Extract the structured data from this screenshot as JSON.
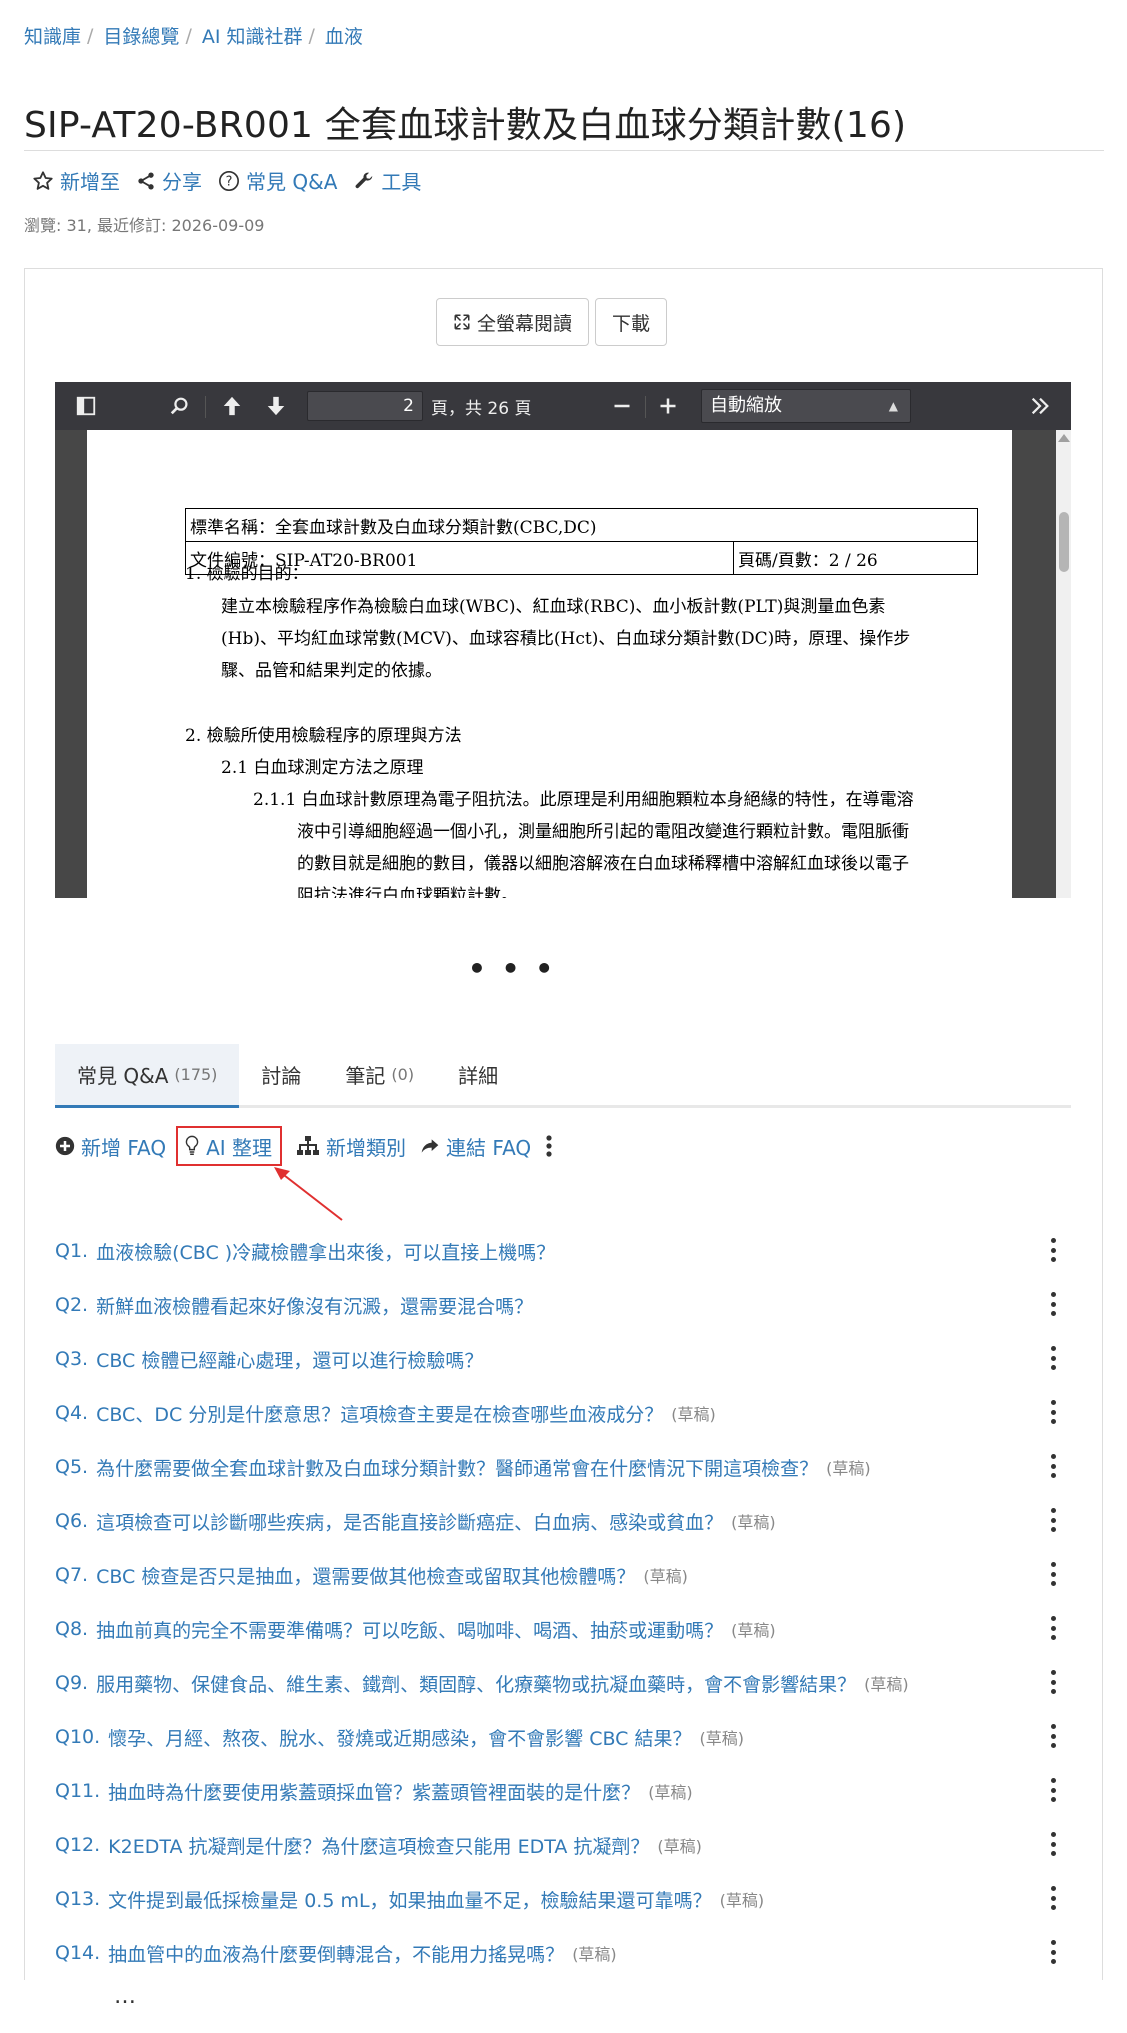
{
  "breadcrumb": [
    "知識庫",
    "目錄總覽",
    "AI 知識社群",
    "血液"
  ],
  "title": "SIP-AT20-BR001 全套血球計數及白血球分類計數(16)",
  "actions": {
    "add": "新增至",
    "share": "分享",
    "faq": "常見 Q&A",
    "tools": "工具"
  },
  "meta": "瀏覽: 31, 最近修訂: 2026-09-09",
  "buttons": {
    "fullscreen": "全螢幕閱讀",
    "download": "下載"
  },
  "viewer": {
    "page": "2",
    "page_of": "頁，共 26 頁",
    "zoom": "自動縮放",
    "doc": {
      "std_name": "標準名稱：全套血球計數及白血球分類計數(CBC,DC)",
      "doc_no": "文件編號：SIP-AT20-BR001",
      "page_info": "頁碼/頁數：2 / 26",
      "s1_title": "1.   檢驗的目的：",
      "s1_l1": "建立本檢驗程序作為檢驗白血球(WBC)、紅血球(RBC)、血小板計數(PLT)與測量血色素",
      "s1_l2": "(Hb)、平均紅血球常數(MCV)、血球容積比(Hct)、白血球分類計數(DC)時，原理、操作步",
      "s1_l3": "驟、品管和結果判定的依據。",
      "s2_title": "2.   檢驗所使用檢驗程序的原理與方法",
      "s21_title": "2.1   白血球測定方法之原理",
      "s211_l1": "2.1.1 白血球計數原理為電子阻抗法。此原理是利用細胞顆粒本身絕緣的特性，在導電溶",
      "s211_l2": "液中引導細胞經過一個小孔，測量細胞所引起的電阻改變進行顆粒計數。電阻脈衝",
      "s211_l3": "的數目就是細胞的數目，儀器以細胞溶解液在白血球稀釋槽中溶解紅血球後以電子",
      "s211_l4": "阻抗法進行白血球顆粒計數。"
    }
  },
  "center_ellipsis": "• • •",
  "tabs": [
    {
      "label": "常見 Q&A",
      "count": "(175)"
    },
    {
      "label": "討論",
      "count": ""
    },
    {
      "label": "筆記",
      "count": "(0)"
    },
    {
      "label": "詳細",
      "count": ""
    }
  ],
  "faq_tools": {
    "add": "新增 FAQ",
    "ai": "AI 整理",
    "category": "新增類別",
    "link": "連結 FAQ"
  },
  "faqs": [
    {
      "n": "Q1.",
      "q": "血液檢驗(CBC )冷藏檢體拿出來後，可以直接上機嗎？",
      "draft": ""
    },
    {
      "n": "Q2.",
      "q": "新鮮血液檢體看起來好像沒有沉澱，還需要混合嗎？",
      "draft": ""
    },
    {
      "n": "Q3.",
      "q": "CBC 檢體已經離心處理，還可以進行檢驗嗎？",
      "draft": ""
    },
    {
      "n": "Q4.",
      "q": "CBC、DC 分別是什麼意思？這項檢查主要是在檢查哪些血液成分？",
      "draft": "(草稿)"
    },
    {
      "n": "Q5.",
      "q": "為什麼需要做全套血球計數及白血球分類計數？醫師通常會在什麼情況下開這項檢查？",
      "draft": "(草稿)"
    },
    {
      "n": "Q6.",
      "q": "這項檢查可以診斷哪些疾病，是否能直接診斷癌症、白血病、感染或貧血？",
      "draft": "(草稿)"
    },
    {
      "n": "Q7.",
      "q": "CBC 檢查是否只是抽血，還需要做其他檢查或留取其他檢體嗎？",
      "draft": "(草稿)"
    },
    {
      "n": "Q8.",
      "q": "抽血前真的完全不需要準備嗎？可以吃飯、喝咖啡、喝酒、抽菸或運動嗎？",
      "draft": "(草稿)"
    },
    {
      "n": "Q9.",
      "q": "服用藥物、保健食品、維生素、鐵劑、類固醇、化療藥物或抗凝血藥時，會不會影響結果？",
      "draft": "(草稿)"
    },
    {
      "n": "Q10.",
      "q": "懷孕、月經、熬夜、脫水、發燒或近期感染，會不會影響 CBC 結果？",
      "draft": "(草稿)"
    },
    {
      "n": "Q11.",
      "q": "抽血時為什麼要使用紫蓋頭採血管？紫蓋頭管裡面裝的是什麼？",
      "draft": "(草稿)"
    },
    {
      "n": "Q12.",
      "q": "K2EDTA 抗凝劑是什麼？為什麼這項檢查只能用 EDTA 抗凝劑？",
      "draft": "(草稿)"
    },
    {
      "n": "Q13.",
      "q": "文件提到最低採檢量是 0.5 mL，如果抽血量不足，檢驗結果還可靠嗎？",
      "draft": "(草稿)"
    },
    {
      "n": "Q14.",
      "q": "抽血管中的血液為什麼要倒轉混合，不能用力搖晃嗎？",
      "draft": "(草稿)"
    }
  ],
  "bottom_ellipsis": "…",
  "colors": {
    "link": "#337ab7",
    "highlight_border": "#e03030",
    "viewer_toolbar": "#38383d"
  }
}
